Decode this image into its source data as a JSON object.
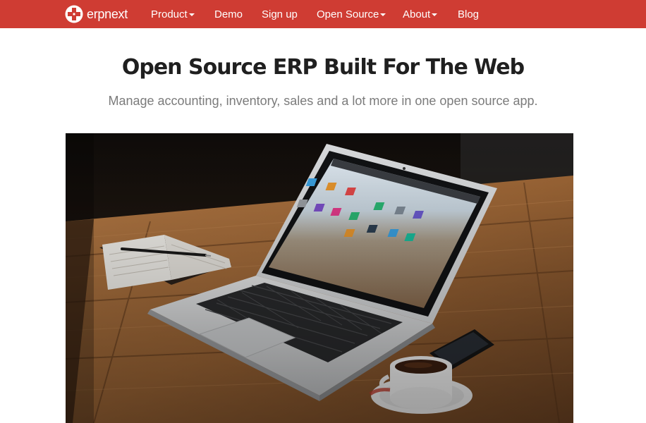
{
  "navbar": {
    "brand": {
      "icon": "erpnext-cross-logo-icon",
      "text": "erpnext"
    },
    "items": [
      {
        "label": "Product",
        "dropdown": true
      },
      {
        "label": "Demo",
        "dropdown": false
      },
      {
        "label": "Sign up",
        "dropdown": false
      },
      {
        "label": "Open Source",
        "dropdown": true
      },
      {
        "label": "About",
        "dropdown": true
      },
      {
        "label": "Blog",
        "dropdown": false
      }
    ]
  },
  "hero": {
    "title": "Open Source ERP Built For The Web",
    "subtitle": "Manage accounting, inventory, sales and a lot more in one open source app.",
    "image": "laptop-on-wooden-desk-photo"
  },
  "colors": {
    "navbar_bg": "#cf3c33",
    "title": "#1f1f1f",
    "subtitle": "#7b7b7b"
  }
}
